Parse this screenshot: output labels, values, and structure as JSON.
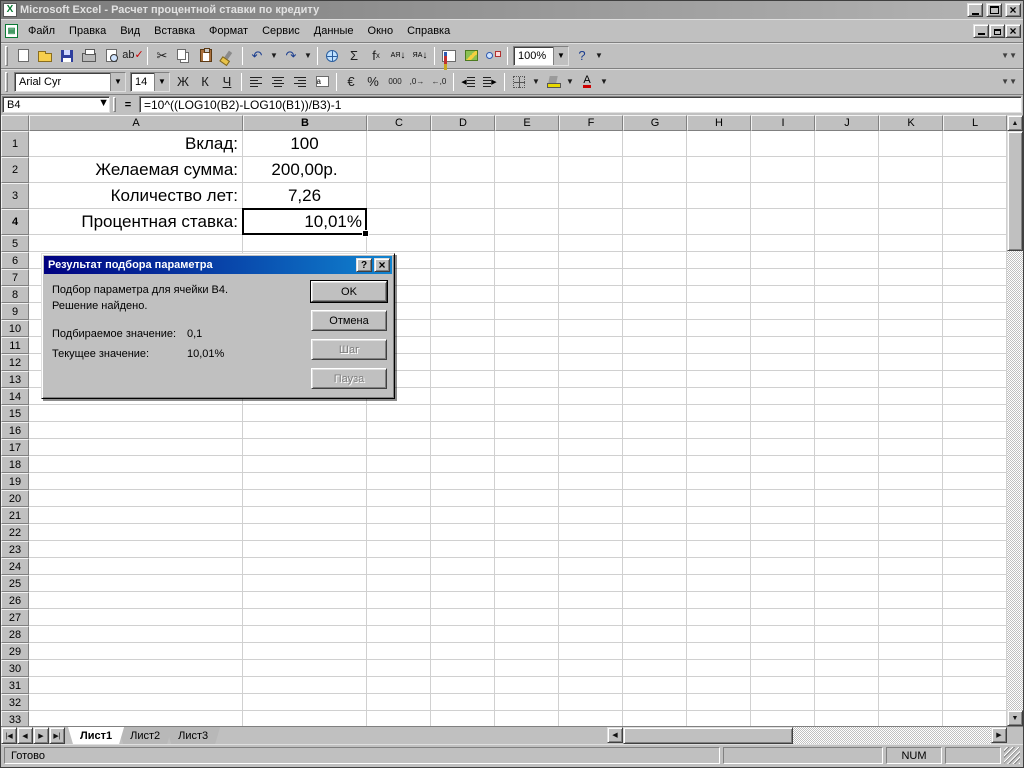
{
  "window": {
    "title": "Microsoft Excel - Расчет процентной ставки по кредиту"
  },
  "menu": {
    "items": [
      "Файл",
      "Правка",
      "Вид",
      "Вставка",
      "Формат",
      "Сервис",
      "Данные",
      "Окно",
      "Справка"
    ]
  },
  "standard_toolbar": {
    "buttons": [
      "new-document",
      "open-folder",
      "save",
      "print",
      "print-preview",
      "spelling",
      "|",
      "cut",
      "copy",
      "paste",
      "format-painter",
      "|",
      "undo",
      "undo-more",
      "redo",
      "redo-more",
      "|",
      "insert-hyperlink",
      "autosum",
      "paste-function",
      "sort-ascending",
      "sort-descending",
      "|",
      "chart-wizard",
      "map",
      "drawing",
      "|"
    ],
    "zoom_value": "100%",
    "trailing_buttons": [
      "help",
      "help-more"
    ]
  },
  "formatting_toolbar": {
    "font_name": "Arial Cyr",
    "font_size": "14",
    "buttons": [
      "bold",
      "italic",
      "underline",
      "|",
      "align-left",
      "align-center",
      "align-right",
      "merge-center",
      "|",
      "currency",
      "percent",
      "comma",
      "increase-decimal",
      "decrease-decimal",
      "|",
      "decrease-indent",
      "increase-indent",
      "|",
      "borders",
      "borders-more",
      "fill-color",
      "fill-more",
      "font-color",
      "font-more"
    ]
  },
  "formula_bar": {
    "name_box": "B4",
    "edit_formula": "=",
    "formula": "=10^((LOG10(B2)-LOG10(B1))/B3)-1"
  },
  "grid": {
    "column_headers": [
      "A",
      "B",
      "C",
      "D",
      "E",
      "F",
      "G",
      "H",
      "I",
      "J",
      "K",
      "L"
    ],
    "row_count": 33,
    "active_column": "B",
    "active_row": 4,
    "cells": [
      {
        "ref": "A1",
        "col": "A",
        "row": 1,
        "text": "Вклад:",
        "align": "right"
      },
      {
        "ref": "B1",
        "col": "B",
        "row": 1,
        "text": "100",
        "align": "center"
      },
      {
        "ref": "A2",
        "col": "A",
        "row": 2,
        "text": "Желаемая сумма:",
        "align": "right"
      },
      {
        "ref": "B2",
        "col": "B",
        "row": 2,
        "text": "200,00р.",
        "align": "center"
      },
      {
        "ref": "A3",
        "col": "A",
        "row": 3,
        "text": "Количество лет:",
        "align": "right"
      },
      {
        "ref": "B3",
        "col": "B",
        "row": 3,
        "text": "7,26",
        "align": "center"
      },
      {
        "ref": "A4",
        "col": "A",
        "row": 4,
        "text": "Процентная ставка:",
        "align": "right"
      },
      {
        "ref": "B4",
        "col": "B",
        "row": 4,
        "text": "10,01%",
        "align": "right"
      }
    ]
  },
  "dialog": {
    "title": "Результат подбора параметра",
    "message_line1": "Подбор параметра для ячейки B4.",
    "message_line2": "Решение найдено.",
    "fields": [
      {
        "label": "Подбираемое значение:",
        "value": "0,1"
      },
      {
        "label": "Текущее значение:",
        "value": "10,01%"
      }
    ],
    "buttons": [
      {
        "name": "ok",
        "label": "OK",
        "enabled": true,
        "default": true
      },
      {
        "name": "cancel",
        "label": "Отмена",
        "enabled": true,
        "default": false
      },
      {
        "name": "step",
        "label": "Шаг",
        "enabled": false,
        "default": false
      },
      {
        "name": "pause",
        "label": "Пауза",
        "enabled": false,
        "default": false
      }
    ]
  },
  "sheet_tabs": [
    {
      "label": "Лист1",
      "active": true
    },
    {
      "label": "Лист2",
      "active": false
    },
    {
      "label": "Лист3",
      "active": false
    }
  ],
  "status_bar": {
    "mode": "Готово",
    "num_lock": "NUM"
  },
  "colors": {
    "chrome": "#c0c0c0",
    "dialog_title_start": "#000080",
    "dialog_title_end": "#1084d0",
    "inactive_title_start": "#7a7a7a",
    "inactive_title_end": "#b4b4b4",
    "gridline": "#d0d0d0"
  }
}
